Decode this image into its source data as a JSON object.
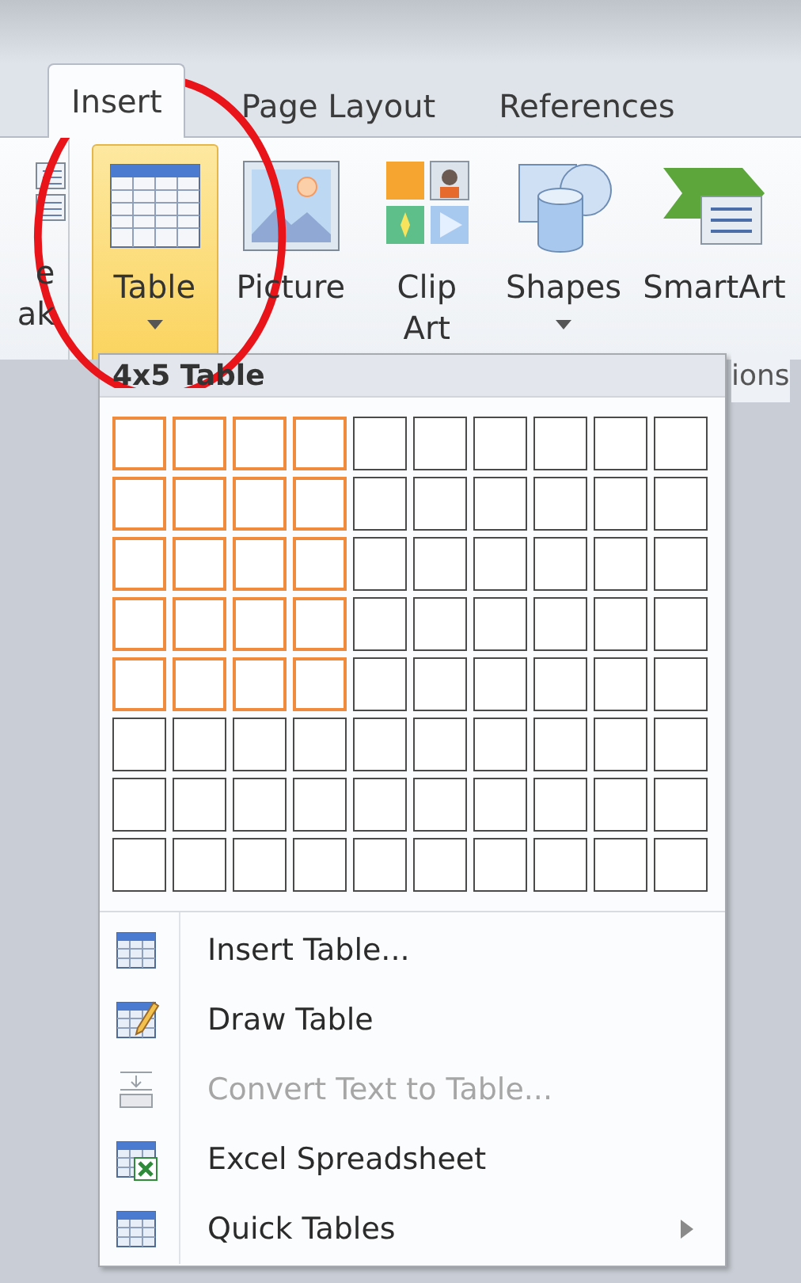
{
  "tabs": [
    {
      "label": "Insert",
      "selected": true
    },
    {
      "label": "Page Layout",
      "selected": false
    },
    {
      "label": "References",
      "selected": false
    }
  ],
  "ribbon": {
    "partial_button": {
      "line_1": "e",
      "line_2": "ak"
    },
    "buttons": [
      {
        "kind": "table",
        "label": "Table",
        "dropdown": true,
        "selected": true
      },
      {
        "kind": "picture",
        "label": "Picture",
        "dropdown": false,
        "selected": false
      },
      {
        "kind": "clipart",
        "label": "Clip\nArt",
        "dropdown": false,
        "selected": false
      },
      {
        "kind": "shapes",
        "label": "Shapes",
        "dropdown": true,
        "selected": false
      },
      {
        "kind": "smartart",
        "label": "SmartArt",
        "dropdown": false,
        "selected": false
      }
    ],
    "group_label": "ions"
  },
  "table_menu": {
    "header": "4x5 Table",
    "grid_rows": [
      {
        "cells": [
          {
            "selected": true
          },
          {
            "selected": true
          },
          {
            "selected": true
          },
          {
            "selected": true
          },
          {
            "selected": false
          },
          {
            "selected": false
          },
          {
            "selected": false
          },
          {
            "selected": false
          },
          {
            "selected": false
          },
          {
            "selected": false
          }
        ]
      },
      {
        "cells": [
          {
            "selected": true
          },
          {
            "selected": true
          },
          {
            "selected": true
          },
          {
            "selected": true
          },
          {
            "selected": false
          },
          {
            "selected": false
          },
          {
            "selected": false
          },
          {
            "selected": false
          },
          {
            "selected": false
          },
          {
            "selected": false
          }
        ]
      },
      {
        "cells": [
          {
            "selected": true
          },
          {
            "selected": true
          },
          {
            "selected": true
          },
          {
            "selected": true
          },
          {
            "selected": false
          },
          {
            "selected": false
          },
          {
            "selected": false
          },
          {
            "selected": false
          },
          {
            "selected": false
          },
          {
            "selected": false
          }
        ]
      },
      {
        "cells": [
          {
            "selected": true
          },
          {
            "selected": true
          },
          {
            "selected": true
          },
          {
            "selected": true
          },
          {
            "selected": false
          },
          {
            "selected": false
          },
          {
            "selected": false
          },
          {
            "selected": false
          },
          {
            "selected": false
          },
          {
            "selected": false
          }
        ]
      },
      {
        "cells": [
          {
            "selected": true
          },
          {
            "selected": true
          },
          {
            "selected": true
          },
          {
            "selected": true
          },
          {
            "selected": false
          },
          {
            "selected": false
          },
          {
            "selected": false
          },
          {
            "selected": false
          },
          {
            "selected": false
          },
          {
            "selected": false
          }
        ]
      },
      {
        "cells": [
          {
            "selected": false
          },
          {
            "selected": false
          },
          {
            "selected": false
          },
          {
            "selected": false
          },
          {
            "selected": false
          },
          {
            "selected": false
          },
          {
            "selected": false
          },
          {
            "selected": false
          },
          {
            "selected": false
          },
          {
            "selected": false
          }
        ]
      },
      {
        "cells": [
          {
            "selected": false
          },
          {
            "selected": false
          },
          {
            "selected": false
          },
          {
            "selected": false
          },
          {
            "selected": false
          },
          {
            "selected": false
          },
          {
            "selected": false
          },
          {
            "selected": false
          },
          {
            "selected": false
          },
          {
            "selected": false
          }
        ]
      },
      {
        "cells": [
          {
            "selected": false
          },
          {
            "selected": false
          },
          {
            "selected": false
          },
          {
            "selected": false
          },
          {
            "selected": false
          },
          {
            "selected": false
          },
          {
            "selected": false
          },
          {
            "selected": false
          },
          {
            "selected": false
          },
          {
            "selected": false
          }
        ]
      }
    ],
    "items": [
      {
        "kind": "insert",
        "label": "Insert Table...",
        "disabled": false,
        "submenu": false
      },
      {
        "kind": "draw",
        "label": "Draw Table",
        "disabled": false,
        "submenu": false
      },
      {
        "kind": "convert",
        "label": "Convert Text to Table...",
        "disabled": true,
        "submenu": false
      },
      {
        "kind": "excel",
        "label": "Excel Spreadsheet",
        "disabled": false,
        "submenu": false
      },
      {
        "kind": "quick",
        "label": "Quick Tables",
        "disabled": false,
        "submenu": true
      }
    ]
  }
}
